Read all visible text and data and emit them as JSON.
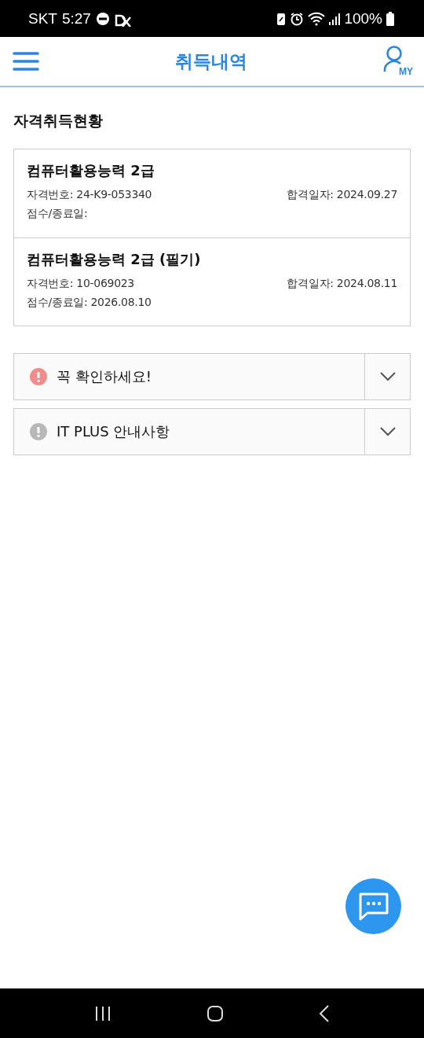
{
  "status_bar": {
    "carrier": "SKT",
    "time": "5:27",
    "battery": "100%"
  },
  "header": {
    "title": "취득내역",
    "my_label": "MY"
  },
  "section_title": "자격취득현황",
  "certificates": [
    {
      "name": "컴퓨터활용능력 2급",
      "number": "자격번호: 24-K9-053340",
      "pass_date": "합격일자: 2024.09.27",
      "score": "점수/종료일:"
    },
    {
      "name": "컴퓨터활용능력 2급 (필기)",
      "number": "자격번호: 10-069023",
      "pass_date": "합격일자: 2024.08.11",
      "score": "점수/종료일: 2026.08.10"
    }
  ],
  "notices": [
    {
      "label": "꼭 확인하세요!",
      "color": "#f28b8b",
      "expanded": false
    },
    {
      "label": "IT PLUS 안내사항",
      "color": "#b8b8b8",
      "expanded": false
    }
  ]
}
